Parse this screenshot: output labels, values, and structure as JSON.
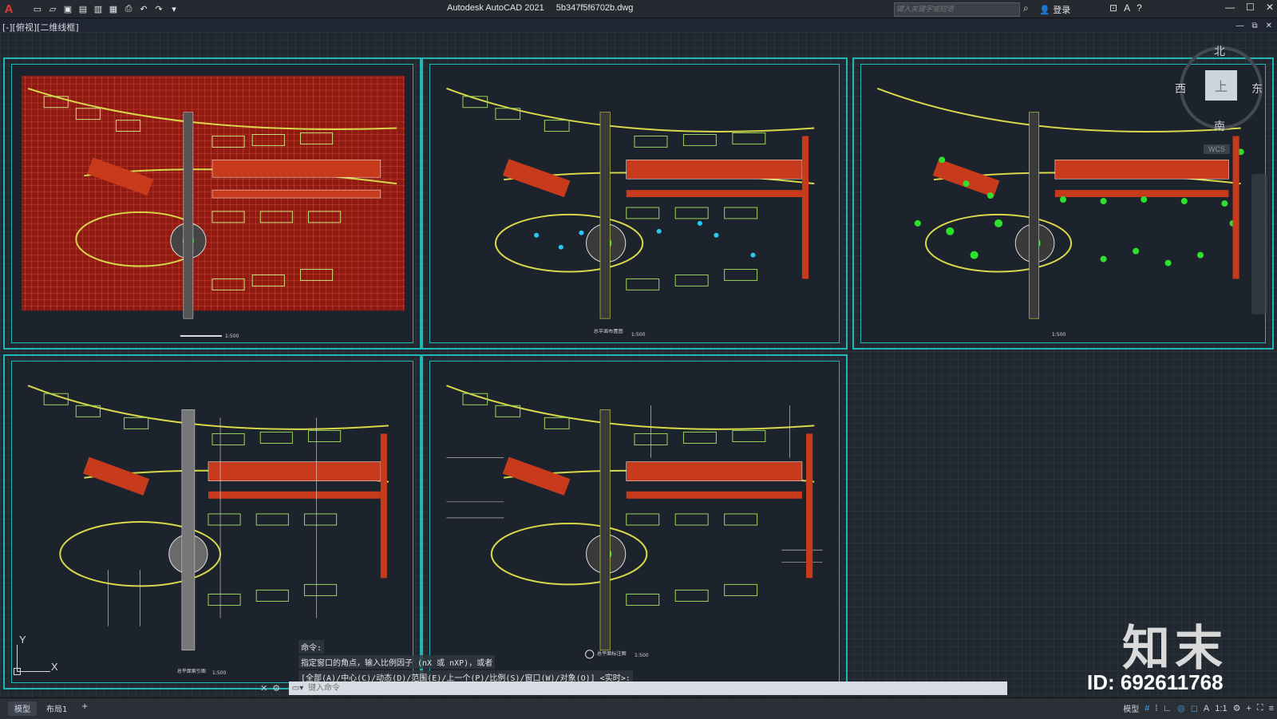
{
  "app": {
    "title": "Autodesk AutoCAD 2021",
    "filename": "5b347f5f6702b.dwg",
    "logo": "A"
  },
  "search": {
    "placeholder": "键入关键字或短语"
  },
  "login_label": "登录",
  "view_label": "[-][俯视][二维线框]",
  "viewcube": {
    "top": "上",
    "north": "北",
    "south": "南",
    "east": "东",
    "west": "西",
    "wcs": "WCS"
  },
  "ucs": {
    "x": "X",
    "y": "Y"
  },
  "command": {
    "history": [
      "命令:",
      "指定窗口的角点，输入比例因子 (nX 或 nXP)，或者",
      "[全部(A)/中心(C)/动态(D)/范围(E)/上一个(P)/比例(S)/窗口(W)/对象(O)] <实时>:"
    ],
    "input_placeholder": "键入命令"
  },
  "tabs": [
    "模型",
    "布局1",
    "+"
  ],
  "status": {
    "model": "模型",
    "scale": "1:1"
  },
  "watermark": {
    "brand": "知末",
    "id": "ID: 692611768"
  },
  "sheets": [
    {
      "name": "grid-plan",
      "scale": "1:500"
    },
    {
      "name": "lighting-plan",
      "label": "总平面布置图",
      "scale": "1:500"
    },
    {
      "name": "planting-plan",
      "scale": "1:500"
    },
    {
      "name": "paving-plan",
      "label": "总平面索引图",
      "scale": "1:500"
    },
    {
      "name": "index-plan",
      "label": "总平面标注图",
      "scale": "1:500"
    }
  ],
  "colors": {
    "frame": "#1fb7b4",
    "grid_red": "#b82418",
    "road": "#d8d84a",
    "building": "#9ad05a",
    "parking": "#c83a1c",
    "accent_green": "#2de02d",
    "accent_cyan": "#28c8f0"
  }
}
